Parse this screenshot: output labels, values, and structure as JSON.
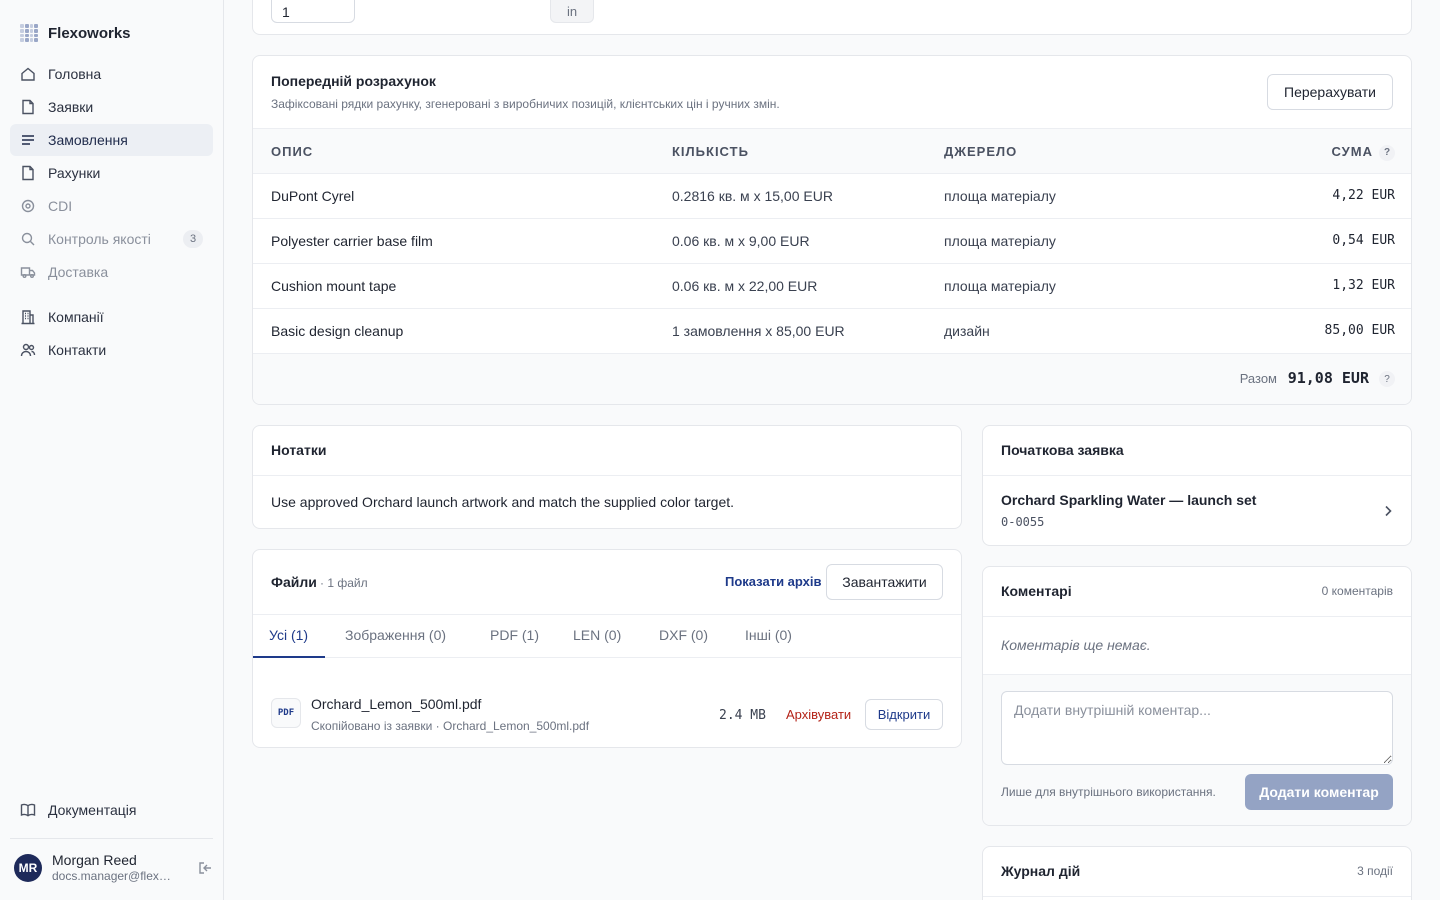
{
  "app": {
    "name": "Flexoworks"
  },
  "sidebar": {
    "items": [
      {
        "label": "Головна"
      },
      {
        "label": "Заявки"
      },
      {
        "label": "Замовлення"
      },
      {
        "label": "Рахунки"
      },
      {
        "label": "CDI"
      },
      {
        "label": "Контроль якості",
        "badge": "3"
      },
      {
        "label": "Доставка"
      },
      {
        "label": "Компанії"
      },
      {
        "label": "Контакти"
      }
    ],
    "docs_label": "Документація",
    "user": {
      "initials": "MR",
      "name": "Morgan Reed",
      "email": "docs.manager@flexoworks.com"
    }
  },
  "top": {
    "quantity_value": "1",
    "unit": "in"
  },
  "estimate": {
    "title": "Попередній розрахунок",
    "subtitle": "Зафіксовані рядки рахунку, згенеровані з виробничих позицій, клієнтських цін і ручних змін.",
    "recalc_label": "Перерахувати",
    "columns": [
      "ОПИС",
      "КІЛЬКІСТЬ",
      "ДЖЕРЕЛО",
      "СУМА"
    ],
    "help_glyph": "?",
    "rows": [
      {
        "description": "DuPont Cyrel",
        "quantity": "0.2816 кв. м x 15,00 EUR",
        "source": "площа матеріалу",
        "amount": "4,22 EUR"
      },
      {
        "description": "Polyester carrier base film",
        "quantity": "0.06 кв. м x 9,00 EUR",
        "source": "площа матеріалу",
        "amount": "0,54 EUR"
      },
      {
        "description": "Cushion mount tape",
        "quantity": "0.06 кв. м x 22,00 EUR",
        "source": "площа матеріалу",
        "amount": "1,32 EUR"
      },
      {
        "description": "Basic design cleanup",
        "quantity": "1 замовлення x 85,00 EUR",
        "source": "дизайн",
        "amount": "85,00 EUR"
      }
    ],
    "total_label": "Разом",
    "total_value": "91,08 EUR"
  },
  "notes": {
    "title": "Нотатки",
    "text": "Use approved Orchard launch artwork and match the supplied color target."
  },
  "files": {
    "title": "Файли",
    "count": "· 1 файл",
    "show_archive": "Показати архів",
    "upload_label": "Завантажити",
    "tabs": [
      "Усі (1)",
      "Зображення (0)",
      "PDF (1)",
      "LEN (0)",
      "DXF (0)",
      "Інші (0)"
    ],
    "items": [
      {
        "type_label": "PDF",
        "name": "Orchard_Lemon_500ml.pdf",
        "meta": "Скопійовано із заявки · Orchard_Lemon_500ml.pdf",
        "size": "2.4 MB",
        "archive_label": "Архівувати",
        "open_label": "Відкрити"
      }
    ]
  },
  "request": {
    "title": "Початкова заявка",
    "name": "Orchard Sparkling Water — launch set",
    "id": "0-0055"
  },
  "comments": {
    "title": "Коментарі",
    "count": "0 коментарів",
    "empty": "Коментарів ще немає.",
    "placeholder": "Додати внутрішній коментар...",
    "internal_note": "Лише для внутрішнього використання.",
    "add_label": "Додати коментар"
  },
  "activity": {
    "title": "Журнал дій",
    "count": "3 події"
  },
  "colors": {
    "accent": "#1e3a8a",
    "danger": "#b42318",
    "disabled_button": "#94a3c4",
    "avatar": "#1e2a5a"
  }
}
